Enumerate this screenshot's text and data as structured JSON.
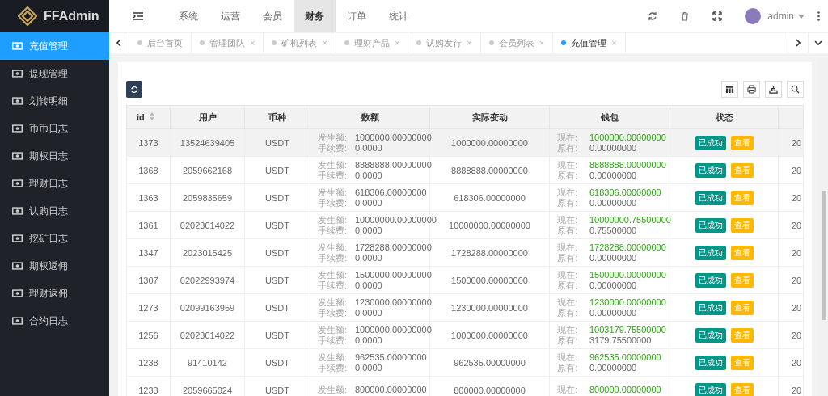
{
  "brand": {
    "name": "FFAdmin"
  },
  "sidebar": {
    "items": [
      {
        "label": "充值管理",
        "selected": true
      },
      {
        "label": "提现管理",
        "selected": false
      },
      {
        "label": "划转明细",
        "selected": false
      },
      {
        "label": "币币日志",
        "selected": false
      },
      {
        "label": "期权日志",
        "selected": false
      },
      {
        "label": "理财日志",
        "selected": false
      },
      {
        "label": "认购日志",
        "selected": false
      },
      {
        "label": "挖矿日志",
        "selected": false
      },
      {
        "label": "期权返佣",
        "selected": false
      },
      {
        "label": "理财返佣",
        "selected": false
      },
      {
        "label": "合约日志",
        "selected": false
      }
    ]
  },
  "top_nav": {
    "items": [
      {
        "label": "系统",
        "selected": false
      },
      {
        "label": "运营",
        "selected": false
      },
      {
        "label": "会员",
        "selected": false
      },
      {
        "label": "财务",
        "selected": true
      },
      {
        "label": "订单",
        "selected": false
      },
      {
        "label": "统计",
        "selected": false
      }
    ],
    "user": "admin"
  },
  "tabs": [
    {
      "label": "后台首页",
      "selected": false
    },
    {
      "label": "管理团队",
      "close": "×",
      "selected": false
    },
    {
      "label": "矿机列表",
      "close": "×",
      "selected": false
    },
    {
      "label": "理财产品",
      "close": "×",
      "selected": false
    },
    {
      "label": "认购发行",
      "close": "×",
      "selected": false
    },
    {
      "label": "会员列表",
      "close": "×",
      "selected": false
    },
    {
      "label": "充值管理",
      "close": "×",
      "selected": true
    }
  ],
  "table": {
    "columns": [
      "id",
      "用户",
      "币种",
      "数额",
      "实际变动",
      "钱包",
      "状态"
    ],
    "rows": [
      {
        "id": "1373",
        "user": "13524639405",
        "coin": "USDT",
        "amount_label": "发生额:",
        "amount": "1000000.00000000",
        "fee_label": "手续费:",
        "fee": "0.0000",
        "actual": "1000000.00000000",
        "now_label": "现在:",
        "now": "1000000.00000000",
        "before_label": "原有:",
        "before": "0.00000000",
        "status": "已成功",
        "action": "查看",
        "column_8": "20",
        "selected": true
      },
      {
        "id": "1368",
        "user": "2059662168",
        "coin": "USDT",
        "amount_label": "发生额:",
        "amount": "8888888.00000000",
        "fee_label": "手续费:",
        "fee": "0.0000",
        "actual": "8888888.00000000",
        "now_label": "现在:",
        "now": "8888888.00000000",
        "before_label": "原有:",
        "before": "0.00000000",
        "status": "已成功",
        "action": "查看",
        "column_8": "20",
        "selected": false
      },
      {
        "id": "1363",
        "user": "2059835659",
        "coin": "USDT",
        "amount_label": "发生额:",
        "amount": "618306.00000000",
        "fee_label": "手续费:",
        "fee": "0.0000",
        "actual": "618306.00000000",
        "now_label": "现在:",
        "now": "618306.00000000",
        "before_label": "原有:",
        "before": "0.00000000",
        "status": "已成功",
        "action": "查看",
        "column_8": "20",
        "selected": false
      },
      {
        "id": "1361",
        "user": "02023014022",
        "coin": "USDT",
        "amount_label": "发生额:",
        "amount": "10000000.00000000",
        "fee_label": "手续费:",
        "fee": "0.0000",
        "actual": "10000000.00000000",
        "now_label": "现在:",
        "now": "10000000.75500000",
        "before_label": "原有:",
        "before": "0.75500000",
        "status": "已成功",
        "action": "查看",
        "column_8": "20",
        "selected": false
      },
      {
        "id": "1347",
        "user": "2023015425",
        "coin": "USDT",
        "amount_label": "发生额:",
        "amount": "1728288.00000000",
        "fee_label": "手续费:",
        "fee": "0.0000",
        "actual": "1728288.00000000",
        "now_label": "现在:",
        "now": "1728288.00000000",
        "before_label": "原有:",
        "before": "0.00000000",
        "status": "已成功",
        "action": "查看",
        "column_8": "20",
        "selected": false
      },
      {
        "id": "1307",
        "user": "02022993974",
        "coin": "USDT",
        "amount_label": "发生额:",
        "amount": "1500000.00000000",
        "fee_label": "手续费:",
        "fee": "0.0000",
        "actual": "1500000.00000000",
        "now_label": "现在:",
        "now": "1500000.00000000",
        "before_label": "原有:",
        "before": "0.00000000",
        "status": "已成功",
        "action": "查看",
        "column_8": "20",
        "selected": false
      },
      {
        "id": "1273",
        "user": "02099163959",
        "coin": "USDT",
        "amount_label": "发生额:",
        "amount": "1230000.00000000",
        "fee_label": "手续费:",
        "fee": "0.0000",
        "actual": "1230000.00000000",
        "now_label": "现在:",
        "now": "1230000.00000000",
        "before_label": "原有:",
        "before": "0.00000000",
        "status": "已成功",
        "action": "查看",
        "column_8": "20",
        "selected": false
      },
      {
        "id": "1256",
        "user": "02023014022",
        "coin": "USDT",
        "amount_label": "发生额:",
        "amount": "1000000.00000000",
        "fee_label": "手续费:",
        "fee": "0.0000",
        "actual": "1000000.00000000",
        "now_label": "现在:",
        "now": "1003179.75500000",
        "before_label": "原有:",
        "before": "3179.75500000",
        "status": "已成功",
        "action": "查看",
        "column_8": "20",
        "selected": false
      },
      {
        "id": "1238",
        "user": "91410142",
        "coin": "USDT",
        "amount_label": "发生额:",
        "amount": "962535.00000000",
        "fee_label": "手续费:",
        "fee": "0.0000",
        "actual": "962535.00000000",
        "now_label": "现在:",
        "now": "962535.00000000",
        "before_label": "原有:",
        "before": "0.00000000",
        "status": "已成功",
        "action": "查看",
        "column_8": "20",
        "selected": false
      },
      {
        "id": "1233",
        "user": "2059665024",
        "coin": "USDT",
        "amount_label": "发生额:",
        "amount": "800000.00000000",
        "actual": "800000.00000000",
        "now_label": "现在:",
        "now": "800000.00000000",
        "status": "已成功",
        "action": "查看",
        "column_8": "20",
        "selected": false
      }
    ]
  }
}
